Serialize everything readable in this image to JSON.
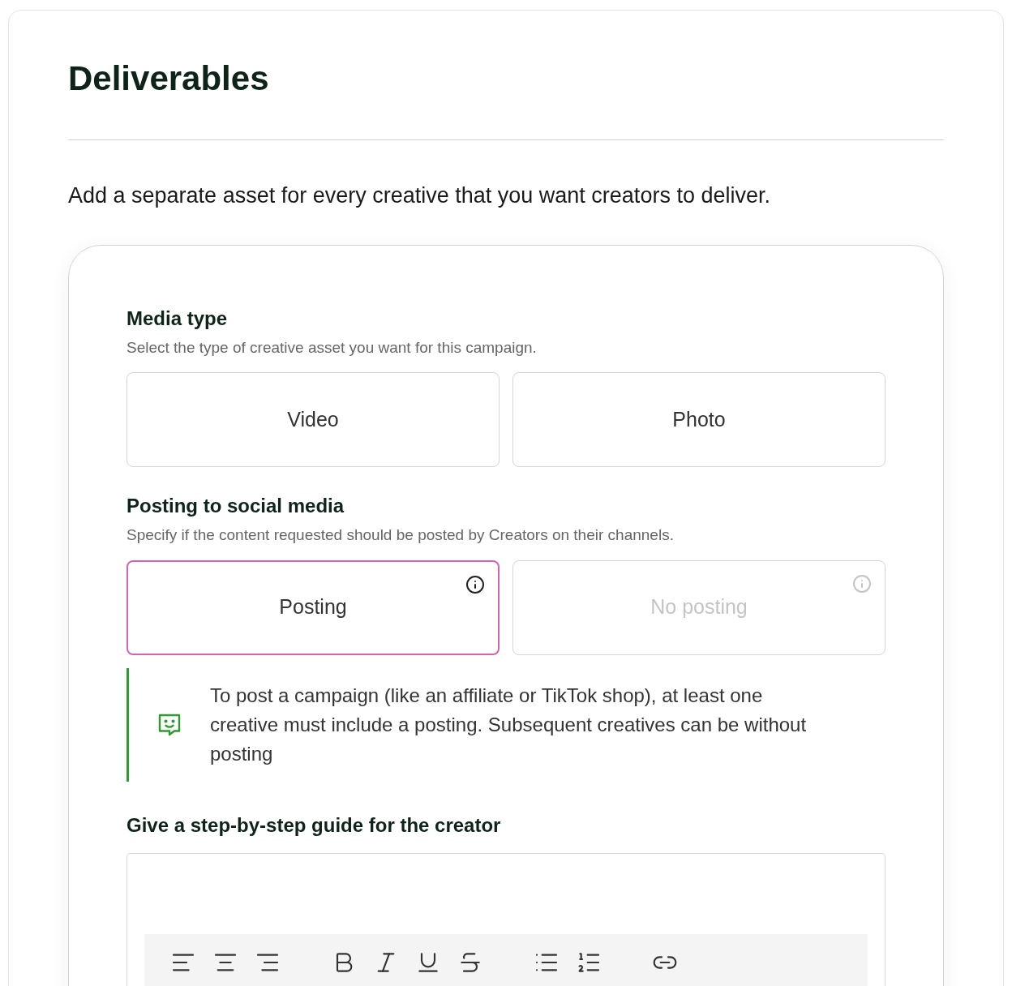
{
  "title": "Deliverables",
  "intro": "Add a separate asset for every creative that you want creators to deliver.",
  "media_type": {
    "label": "Media type",
    "hint": "Select the type of creative asset you want for this campaign.",
    "options": [
      {
        "label": "Video",
        "selected": false,
        "disabled": false,
        "info": false
      },
      {
        "label": "Photo",
        "selected": false,
        "disabled": false,
        "info": false
      }
    ]
  },
  "posting": {
    "label": "Posting to social media",
    "hint": "Specify if the content requested should be posted by Creators on their channels.",
    "options": [
      {
        "label": "Posting",
        "selected": true,
        "disabled": false,
        "info": true
      },
      {
        "label": "No posting",
        "selected": false,
        "disabled": true,
        "info": true
      }
    ],
    "notice": "To post a campaign (like an affiliate or TikTok shop), at least one creative must include a posting. Subsequent creatives can be without posting"
  },
  "guide": {
    "label": "Give a step-by-step guide for the creator"
  }
}
